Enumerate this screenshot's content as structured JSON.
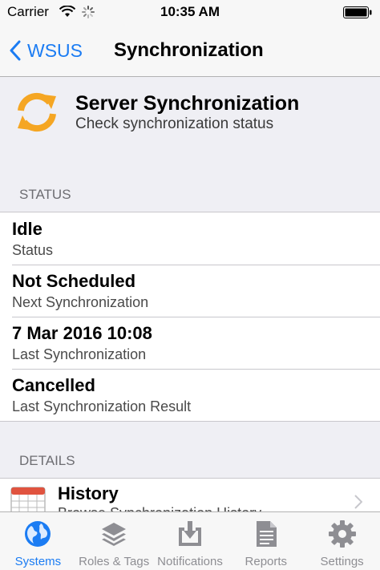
{
  "status_bar": {
    "carrier": "Carrier",
    "time": "10:35 AM"
  },
  "nav": {
    "back_label": "WSUS",
    "title": "Synchronization"
  },
  "header": {
    "title": "Server Synchronization",
    "subtitle": "Check synchronization status"
  },
  "status_section": {
    "heading": "STATUS",
    "rows": [
      {
        "value": "Idle",
        "label": "Status"
      },
      {
        "value": "Not Scheduled",
        "label": "Next Synchronization"
      },
      {
        "value": "7 Mar 2016 10:08",
        "label": "Last Synchronization"
      },
      {
        "value": "Cancelled",
        "label": "Last Synchronization Result"
      }
    ]
  },
  "details_section": {
    "heading": "DETAILS",
    "history": {
      "title": "History",
      "subtitle": "Browse Synchronization History"
    }
  },
  "tabs": [
    {
      "label": "Systems",
      "icon": "globe-icon",
      "active": true
    },
    {
      "label": "Roles & Tags",
      "icon": "layers-icon",
      "active": false
    },
    {
      "label": "Notifications",
      "icon": "download-box-icon",
      "active": false
    },
    {
      "label": "Reports",
      "icon": "document-icon",
      "active": false
    },
    {
      "label": "Settings",
      "icon": "gear-icon",
      "active": false
    }
  ],
  "colors": {
    "accent": "#1b7cf3",
    "sync_orange": "#f5a623",
    "inactive": "#8e8e93"
  }
}
